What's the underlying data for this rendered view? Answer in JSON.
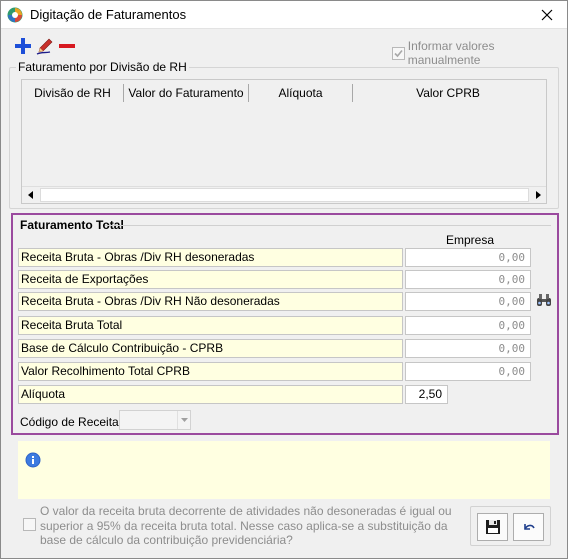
{
  "window": {
    "title": "Digitação de Faturamentos"
  },
  "toolbar": {
    "add_icon": "plus-icon",
    "edit_icon": "pencil-icon",
    "remove_icon": "minus-icon",
    "manual_values_label": "Informar valores manualmente",
    "manual_values_checked": true
  },
  "rh_group": {
    "title": "Faturamento por Divisão de RH",
    "columns": [
      "Divisão de RH",
      "Valor do Faturamento",
      "Alíquota",
      "Valor CPRB"
    ]
  },
  "total": {
    "title": "Faturamento Total",
    "column_header": "Empresa",
    "rows": [
      {
        "label": "Receita Bruta - Obras /Div RH desoneradas",
        "value": "0,00"
      },
      {
        "label": "Receita de Exportações",
        "value": "0,00"
      },
      {
        "label": "Receita Bruta - Obras /Div RH Não desoneradas",
        "value": "0,00"
      },
      {
        "label": "Receita Bruta Total",
        "value": "0,00"
      },
      {
        "label": "Base de Cálculo Contribuição - CPRB",
        "value": "0,00"
      },
      {
        "label": "Valor Recolhimento Total CPRB",
        "value": "0,00"
      },
      {
        "label": "Alíquota",
        "value": "2,50"
      }
    ],
    "codigo_receita_label": "Código de Receita:",
    "codigo_receita_value": ""
  },
  "footer": {
    "substitution_text": "O valor da receita bruta decorrente de atividades não desoneradas é igual ou superior a 95% da receita bruta total. Nesse caso aplica-se a substituição da base de cálculo da contribuição previdenciária?",
    "save_icon": "floppy-disk-icon",
    "undo_icon": "undo-icon"
  },
  "colors": {
    "accent_border": "#9a4a9e",
    "label_bg": "#ffffe1",
    "add": "#1d4fd8",
    "remove": "#d71920"
  }
}
